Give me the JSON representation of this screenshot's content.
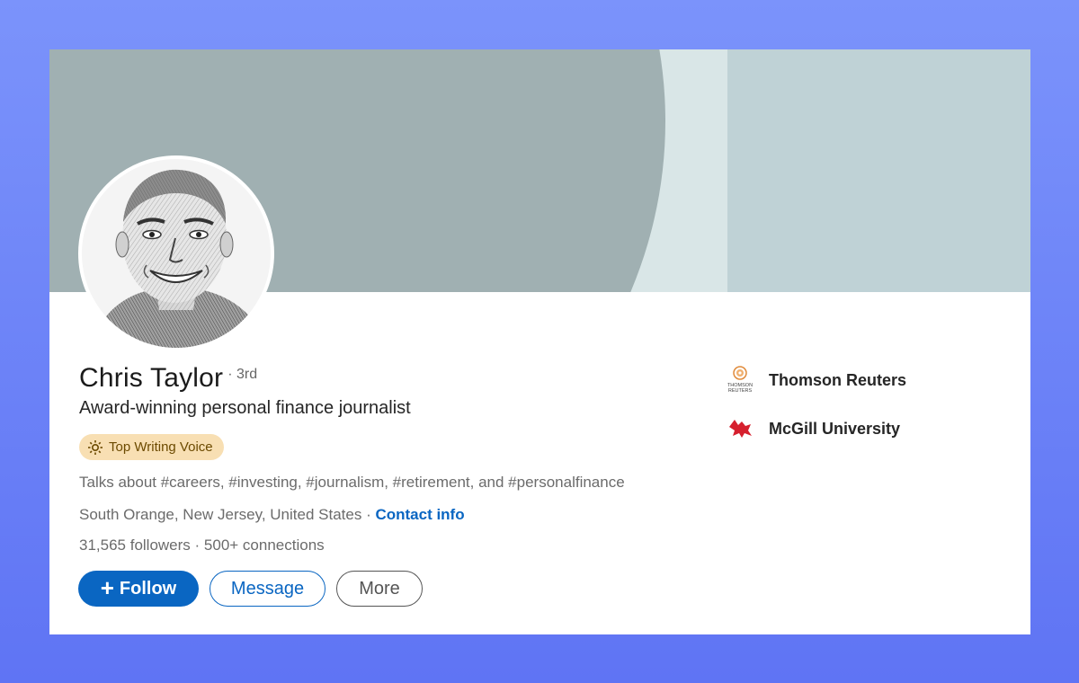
{
  "profile": {
    "name": "Chris Taylor",
    "degree": "· 3rd",
    "headline": "Award-winning personal finance journalist",
    "badge": {
      "label": "Top Writing Voice",
      "icon": "bulb-icon"
    },
    "talks_about": "Talks about #careers, #investing, #journalism, #retirement, and #personalfinance",
    "location": "South Orange, New Jersey, United States",
    "location_separator": " · ",
    "contact_link": "Contact info",
    "followers": "31,565 followers",
    "connections": " · 500+ connections"
  },
  "actions": {
    "follow_plus": "+",
    "follow_label": "Follow",
    "message_label": "Message",
    "more_label": "More"
  },
  "sidebar": {
    "items": [
      {
        "label": "Thomson Reuters",
        "logo": "thomson-reuters-logo",
        "logo_text_1": "THOMSON",
        "logo_text_2": "REUTERS"
      },
      {
        "label": "McGill University",
        "logo": "mcgill-logo"
      }
    ]
  },
  "colors": {
    "background": "#6a82f7",
    "cover_dark": "#a0b0b2",
    "cover_light": "#bfd2d6",
    "primary": "#0a66c2",
    "badge_bg": "#f8dfb3"
  }
}
